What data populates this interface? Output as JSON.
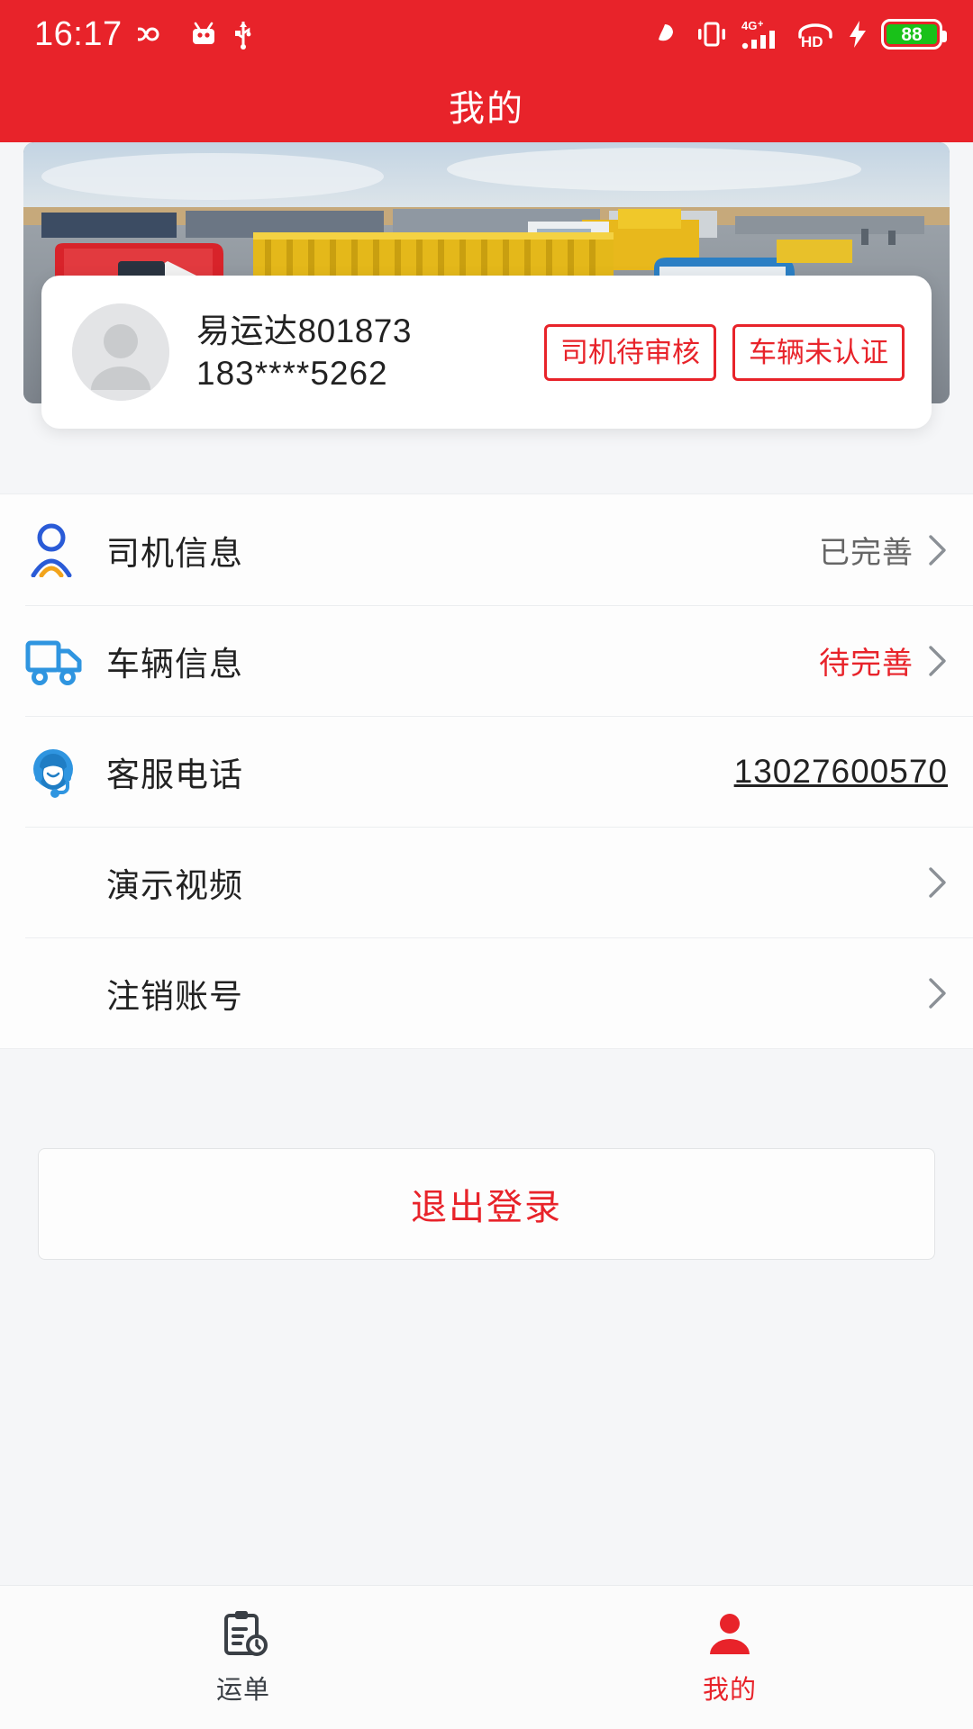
{
  "status_bar": {
    "time": "16:17",
    "left_icons": [
      "infinity-icon",
      "android-robot-icon",
      "usb-icon"
    ],
    "right_icons": [
      "silent-mode-icon",
      "vibrate-icon",
      "signal-4g-plus-icon",
      "hd-voice-icon",
      "charging-bolt-icon"
    ],
    "network_label": "4G",
    "network_plus": "+",
    "hd_label": "HD",
    "battery_level": "88"
  },
  "header": {
    "title": "我的"
  },
  "banner": {
    "name": "truck-fleet-banner",
    "alt": "货车车队图片"
  },
  "profile": {
    "avatar": "default-avatar-icon",
    "name": "易运达801873",
    "phone": "183****5262",
    "badges": [
      {
        "label": "司机待审核",
        "color": "#E8232A"
      },
      {
        "label": "车辆未认证",
        "color": "#E8232A"
      }
    ]
  },
  "menu": {
    "items": [
      {
        "icon": "driver-person-icon",
        "label": "司机信息",
        "value": "已完善",
        "value_style": "gray",
        "chevron": true
      },
      {
        "icon": "truck-icon",
        "label": "车辆信息",
        "value": "待完善",
        "value_style": "red",
        "chevron": true
      },
      {
        "icon": "customer-service-icon",
        "label": "客服电话",
        "value": "13027600570",
        "value_style": "link",
        "chevron": false
      },
      {
        "icon": "",
        "label": "演示视频",
        "value": "",
        "value_style": "none",
        "chevron": true
      },
      {
        "icon": "",
        "label": "注销账号",
        "value": "",
        "value_style": "none",
        "chevron": true
      }
    ]
  },
  "logout": {
    "label": "退出登录",
    "color": "#E8232A"
  },
  "bottom_nav": {
    "tabs": [
      {
        "icon": "waybill-clipboard-icon",
        "label": "运单",
        "active": false
      },
      {
        "icon": "profile-person-icon",
        "label": "我的",
        "active": true
      }
    ]
  },
  "theme": {
    "brand_red": "#E8232A",
    "accent_blue": "#2a7fe0",
    "page_bg": "#f5f6f8"
  }
}
